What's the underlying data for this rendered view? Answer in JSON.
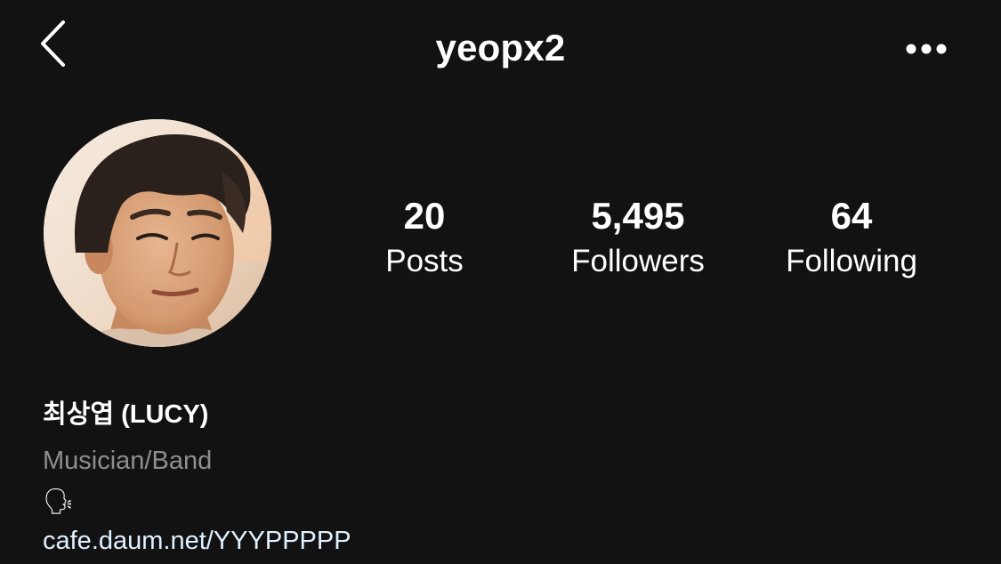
{
  "header": {
    "username": "yeopx2",
    "back_icon": "chevron-left-icon",
    "more_icon": "more-horizontal-icon"
  },
  "stats": {
    "posts": {
      "value": "20",
      "label": "Posts"
    },
    "followers": {
      "value": "5,495",
      "label": "Followers"
    },
    "following": {
      "value": "64",
      "label": "Following"
    }
  },
  "bio": {
    "display_name": "최상엽 (LUCY)",
    "category": "Musician/Band",
    "emoji": "🗣",
    "link": "cafe.daum.net/YYYPPPPP"
  },
  "colors": {
    "background": "#121212",
    "text": "#ffffff",
    "secondary_text": "#8e8e8e",
    "link": "#e0f1ff"
  }
}
